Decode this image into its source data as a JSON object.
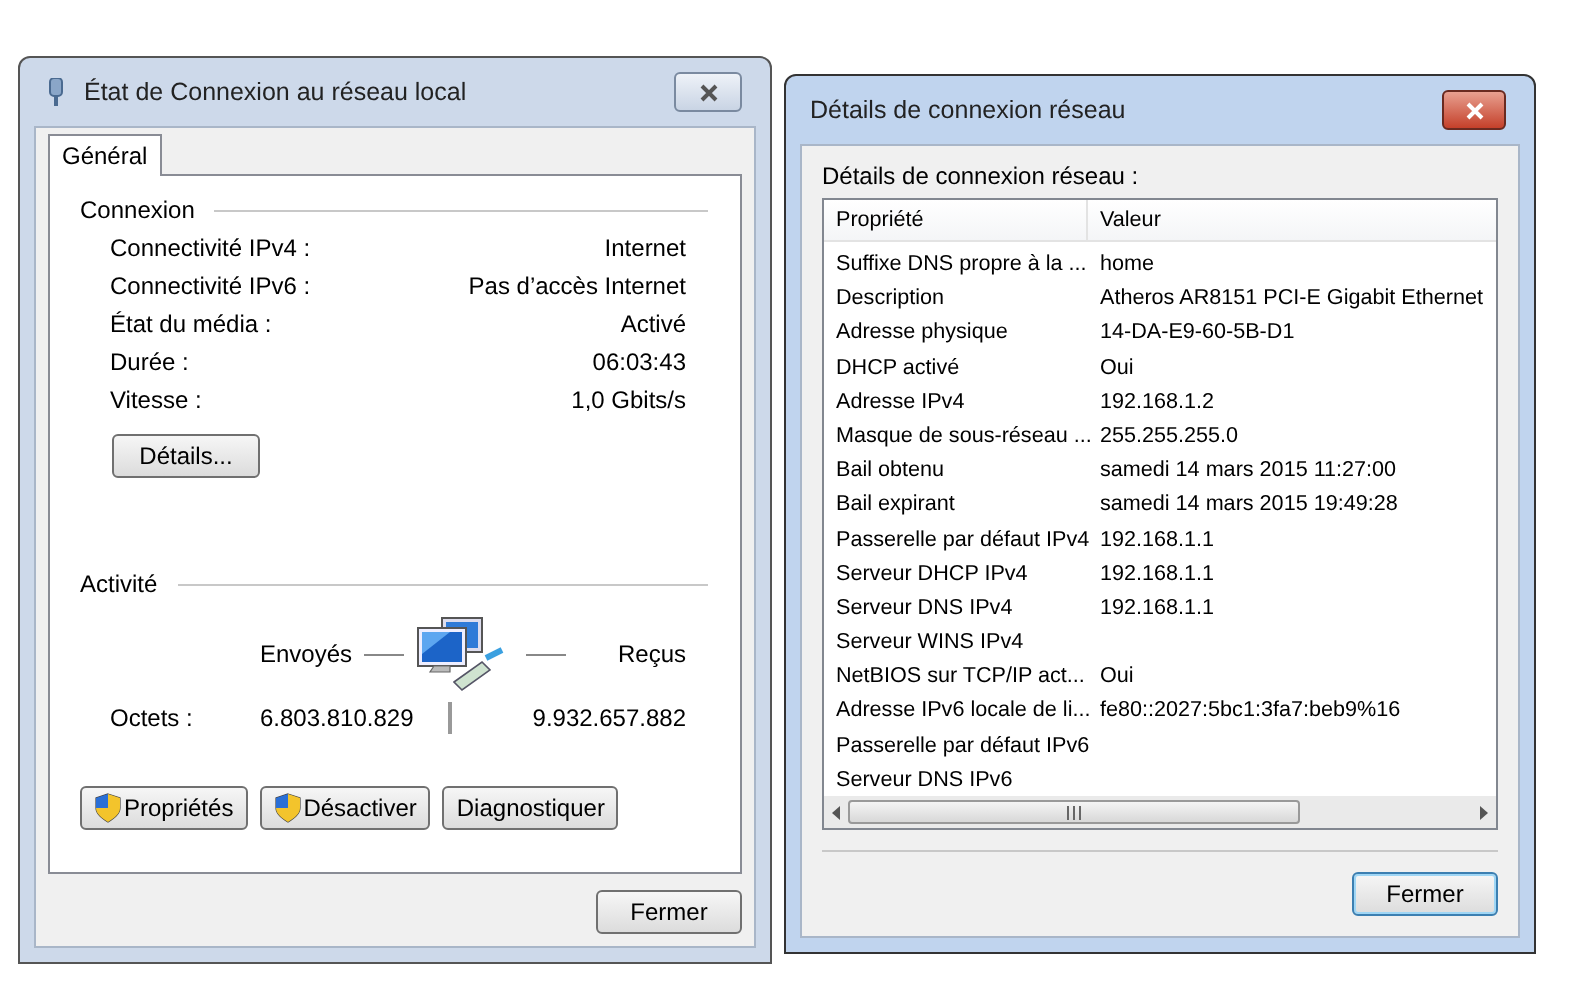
{
  "status_window": {
    "title": "État de Connexion au réseau local",
    "active": false,
    "tabs": [
      {
        "label": "Général",
        "selected": true
      }
    ],
    "connexion": {
      "heading": "Connexion",
      "rows": [
        {
          "label": "Connectivité IPv4 :",
          "value": "Internet"
        },
        {
          "label": "Connectivité IPv6 :",
          "value": "Pas d’accès Internet"
        },
        {
          "label": "État du média :",
          "value": "Activé"
        },
        {
          "label": "Durée :",
          "value": "06:03:43"
        },
        {
          "label": "Vitesse :",
          "value": "1,0 Gbits/s"
        }
      ],
      "details_button": "Détails..."
    },
    "activite": {
      "heading": "Activité",
      "sent_label": "Envoyés",
      "received_label": "Reçus",
      "bytes_label": "Octets :",
      "sent": "6.803.810.829",
      "received": "9.932.657.882"
    },
    "buttons": [
      {
        "label": "Propriétés",
        "shield": true
      },
      {
        "label": "Désactiver",
        "shield": true
      },
      {
        "label": "Diagnostiquer",
        "shield": false
      }
    ],
    "close_label": "Fermer"
  },
  "details_window": {
    "title": "Détails de connexion réseau",
    "active": true,
    "label": "Détails de connexion réseau :",
    "columns": [
      "Propriété",
      "Valeur"
    ],
    "rows": [
      {
        "property": "Suffixe DNS propre à la ...",
        "value": "home"
      },
      {
        "property": "Description",
        "value": "Atheros AR8151 PCI-E Gigabit Ethernet"
      },
      {
        "property": "Adresse physique",
        "value": "14-DA-E9-60-5B-D1"
      },
      {
        "property": "DHCP activé",
        "value": "Oui"
      },
      {
        "property": "Adresse IPv4",
        "value": "192.168.1.2"
      },
      {
        "property": "Masque de sous-réseau ...",
        "value": "255.255.255.0"
      },
      {
        "property": "Bail obtenu",
        "value": "samedi 14 mars 2015 11:27:00"
      },
      {
        "property": "Bail expirant",
        "value": "samedi 14 mars 2015 19:49:28"
      },
      {
        "property": "Passerelle par défaut IPv4",
        "value": "192.168.1.1"
      },
      {
        "property": "Serveur DHCP IPv4",
        "value": "192.168.1.1"
      },
      {
        "property": "Serveur DNS IPv4",
        "value": "192.168.1.1"
      },
      {
        "property": "Serveur WINS IPv4"
      },
      {
        "property": "NetBIOS sur TCP/IP act...",
        "value": "Oui"
      },
      {
        "property": "Adresse IPv6 locale de li...",
        "value": "fe80::2027:5bc1:3fa7:beb9%16"
      },
      {
        "property": "Passerelle par défaut IPv6"
      },
      {
        "property": "Serveur DNS IPv6"
      }
    ],
    "close_label": "Fermer"
  }
}
